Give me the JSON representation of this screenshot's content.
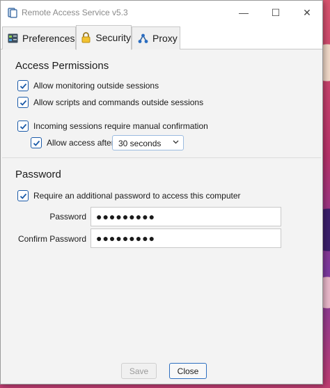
{
  "window": {
    "title": "Remote Access Service v5.3",
    "minimize_glyph": "—",
    "maximize_glyph": "☐",
    "close_glyph": "✕"
  },
  "tabs": [
    {
      "label": "Preferences",
      "icon": "preferences-icon"
    },
    {
      "label": "Security",
      "icon": "lock-icon",
      "selected": true
    },
    {
      "label": "Proxy",
      "icon": "proxy-network-icon"
    }
  ],
  "access": {
    "title": "Access Permissions",
    "options": [
      {
        "label": "Allow monitoring outside sessions",
        "checked": true
      },
      {
        "label": "Allow scripts and commands outside sessions",
        "checked": true
      },
      {
        "label": "Incoming sessions require manual confirmation",
        "checked": true
      }
    ],
    "allow_after": {
      "label": "Allow access after",
      "checked": true,
      "value": "30 seconds"
    }
  },
  "password": {
    "title": "Password",
    "require": {
      "label": "Require an additional password to access this computer",
      "checked": true
    },
    "password_label": "Password",
    "password_value": "●●●●●●●●●",
    "confirm_label": "Confirm Password",
    "confirm_value": "●●●●●●●●●"
  },
  "footer": {
    "save_label": "Save",
    "close_label": "Close"
  },
  "colors": {
    "accent": "#1a5aa8",
    "window_bg": "#f3f3f3"
  }
}
